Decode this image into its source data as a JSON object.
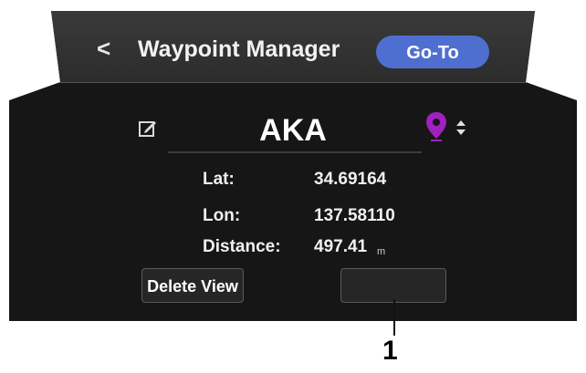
{
  "header": {
    "back_icon": "chevron-left-icon",
    "back_glyph": "<",
    "title": "Waypoint Manager",
    "goto_label": "Go-To"
  },
  "waypoint": {
    "name": "AKA",
    "edit_icon": "edit-icon",
    "pin_icon": "map-pin-icon",
    "pin_color": "#a020c0",
    "sort_icon": "up-down-arrows-icon"
  },
  "details": {
    "lat_label": "Lat:",
    "lat_value": "34.69164",
    "lon_label": "Lon:",
    "lon_value": "137.58110",
    "distance_label": "Distance:",
    "distance_value": "497.41",
    "distance_unit": "m"
  },
  "actions": {
    "delete_view_label": "Delete View",
    "blank_button_label": ""
  },
  "callout": {
    "number": "1"
  },
  "colors": {
    "accent": "#4f6fd0",
    "background": "#161616"
  }
}
